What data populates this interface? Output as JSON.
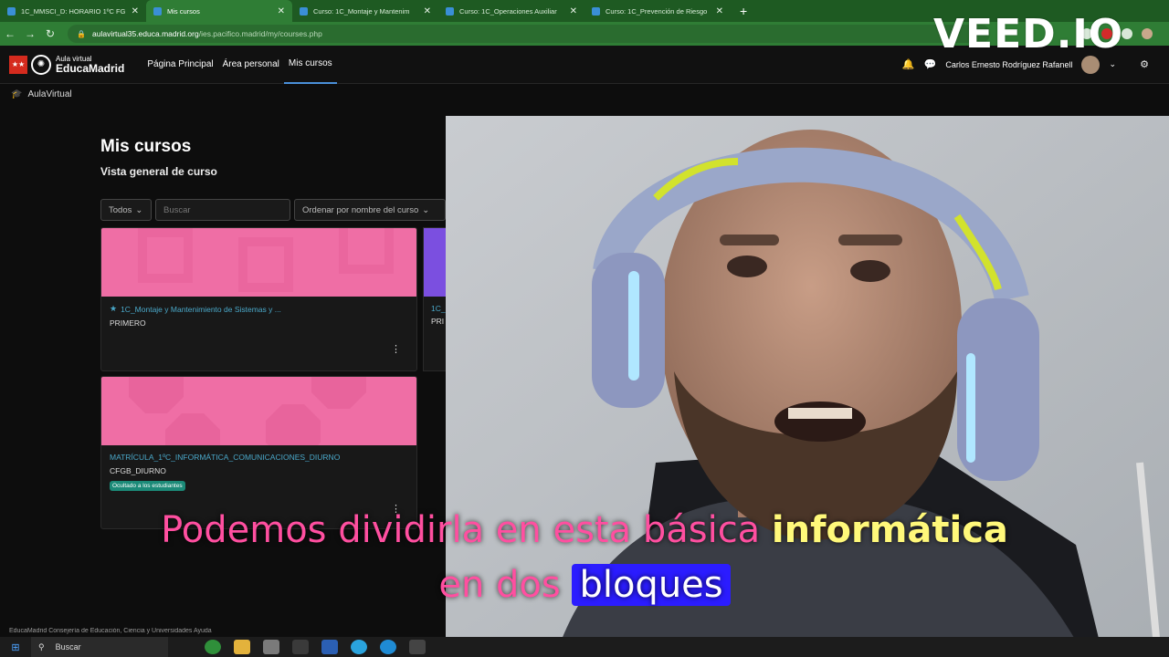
{
  "browser": {
    "tabs": [
      {
        "label": "1C_MMSCI_D: HORARIO 1ºC FG",
        "active": false
      },
      {
        "label": "Mis cursos",
        "active": true
      },
      {
        "label": "Curso: 1C_Montaje y Mantenim",
        "active": false
      },
      {
        "label": "Curso: 1C_Operaciones Auxiliar",
        "active": false
      },
      {
        "label": "Curso: 1C_Prevención de Riesgo",
        "active": false
      }
    ],
    "url_host": "aulavirtual35.educa.madrid.org",
    "url_path": "/ies.pacifico.madrid/my/courses.php"
  },
  "navbar": {
    "logo_small": "Aula virtual",
    "logo_big": "EducaMadrid",
    "links": [
      "Página Principal",
      "Área personal",
      "Mis cursos"
    ],
    "active_link": "Mis cursos",
    "user_name": "Carlos Ernesto Rodríguez Rafanell"
  },
  "breadcrumb": "AulaVirtual",
  "page": {
    "title": "Mis cursos",
    "subtitle": "Vista general de curso",
    "filter_value": "Todos",
    "search_placeholder": "Buscar",
    "sort_value": "Ordenar por nombre del curso"
  },
  "courses": [
    {
      "name": "1C_Montaje y Mantenimiento de Sistemas y ...",
      "category": "PRIMERO",
      "starred": true,
      "color": "#ef6ea5"
    },
    {
      "name": "MATRÍCULA_1ºC_INFORMÁTICA_COMUNICACIONES_DIURNO",
      "category": "CFGB_DIURNO",
      "badge": "Ocultado a los estudiantes",
      "color": "#ef6ea5"
    },
    {
      "name": "1C_",
      "category": "PRI",
      "color": "#7b4fe0"
    }
  ],
  "footer_text": "EducaMadrid   Consejería de Educación, Ciencia y Universidades   Ayuda",
  "taskbar": {
    "search_label": "Buscar"
  },
  "watermark": "VEED.IO",
  "captions": {
    "line1_plain": "Podemos dividirla en esta básica ",
    "line1_highlight": "informática",
    "line2_plain": "en dos ",
    "line2_boxed": "bloques"
  }
}
